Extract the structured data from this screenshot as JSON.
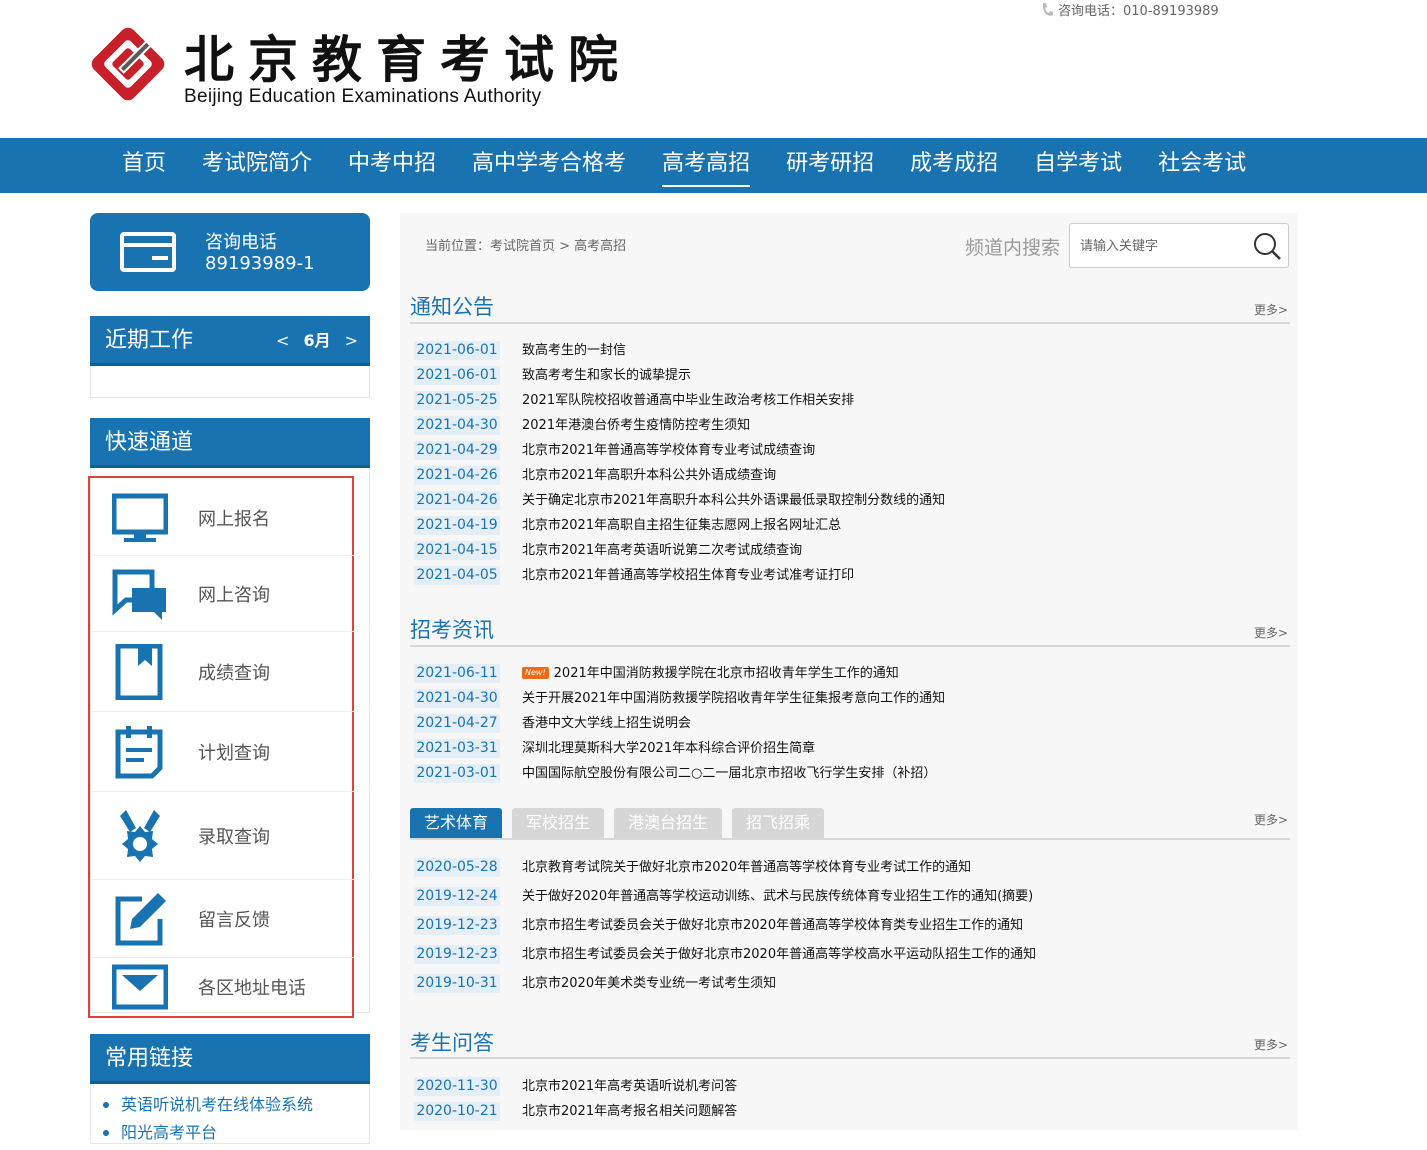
{
  "header": {
    "logo_cn": "北京教育考试院",
    "logo_en": "Beijing Education Examinations Authority",
    "hotline": "咨询电话：010-89193989"
  },
  "nav": {
    "items": [
      {
        "label": "首页"
      },
      {
        "label": "考试院简介"
      },
      {
        "label": "中考中招"
      },
      {
        "label": "高中学考合格考"
      },
      {
        "label": "高考高招",
        "active": true
      },
      {
        "label": "研考研招"
      },
      {
        "label": "成考成招"
      },
      {
        "label": "自学考试"
      },
      {
        "label": "社会考试"
      }
    ]
  },
  "sidebar": {
    "hotline_label": "咨询电话",
    "hotline_number": "89193989-1",
    "recent_title": "近期工作",
    "month": "6月",
    "prev": "<",
    "next": ">",
    "quick_title": "快速通道",
    "quick_items": [
      {
        "label": "网上报名",
        "icon": "monitor-icon"
      },
      {
        "label": "网上咨询",
        "icon": "chat-icon"
      },
      {
        "label": "成绩查询",
        "icon": "bookmark-icon"
      },
      {
        "label": "计划查询",
        "icon": "calendar-icon"
      },
      {
        "label": "录取查询",
        "icon": "medal-icon"
      },
      {
        "label": "留言反馈",
        "icon": "edit-icon"
      },
      {
        "label": "各区地址电话",
        "icon": "envelope-icon"
      }
    ],
    "links_title": "常用链接",
    "links": [
      {
        "label": "英语听说机考在线体验系统"
      },
      {
        "label": "阳光高考平台"
      }
    ]
  },
  "main": {
    "breadcrumb": "当前位置：考试院首页 > 高考高招",
    "search_label": "频道内搜索",
    "search_placeholder": "请输入关键字",
    "more": "更多>",
    "notice": {
      "title": "通知公告",
      "items": [
        {
          "date": "2021-06-01",
          "title": "致高考生的一封信"
        },
        {
          "date": "2021-06-01",
          "title": "致高考考生和家长的诚挚提示"
        },
        {
          "date": "2021-05-25",
          "title": "2021军队院校招收普通高中毕业生政治考核工作相关安排"
        },
        {
          "date": "2021-04-30",
          "title": "2021年港澳台侨考生疫情防控考生须知"
        },
        {
          "date": "2021-04-29",
          "title": "北京市2021年普通高等学校体育专业考试成绩查询"
        },
        {
          "date": "2021-04-26",
          "title": "北京市2021年高职升本科公共外语成绩查询"
        },
        {
          "date": "2021-04-26",
          "title": "关于确定北京市2021年高职升本科公共外语课最低录取控制分数线的通知"
        },
        {
          "date": "2021-04-19",
          "title": "北京市2021年高职自主招生征集志愿网上报名网址汇总"
        },
        {
          "date": "2021-04-15",
          "title": "北京市2021年高考英语听说第二次考试成绩查询"
        },
        {
          "date": "2021-04-05",
          "title": "北京市2021年普通高等学校招生体育专业考试准考证打印"
        }
      ]
    },
    "news": {
      "title": "招考资讯",
      "new_badge": "New!",
      "items": [
        {
          "date": "2021-06-11",
          "title": "2021年中国消防救援学院在北京市招收青年学生工作的通知",
          "is_new": true
        },
        {
          "date": "2021-04-30",
          "title": "关于开展2021年中国消防救援学院招收青年学生征集报考意向工作的通知"
        },
        {
          "date": "2021-04-27",
          "title": "香港中文大学线上招生说明会"
        },
        {
          "date": "2021-03-31",
          "title": "深圳北理莫斯科大学2021年本科综合评价招生简章"
        },
        {
          "date": "2021-03-01",
          "title": "中国国际航空股份有限公司二○二一届北京市招收飞行学生安排（补招）"
        }
      ]
    },
    "tabs": {
      "items": [
        {
          "label": "艺术体育",
          "active": true
        },
        {
          "label": "军校招生"
        },
        {
          "label": "港澳台招生"
        },
        {
          "label": "招飞招乘"
        }
      ],
      "list": [
        {
          "date": "2020-05-28",
          "title": "北京教育考试院关于做好北京市2020年普通高等学校体育专业考试工作的通知"
        },
        {
          "date": "2019-12-24",
          "title": "关于做好2020年普通高等学校运动训练、武术与民族传统体育专业招生工作的通知(摘要)"
        },
        {
          "date": "2019-12-23",
          "title": "北京市招生考试委员会关于做好北京市2020年普通高等学校体育类专业招生工作的通知"
        },
        {
          "date": "2019-12-23",
          "title": "北京市招生考试委员会关于做好北京市2020年普通高等学校高水平运动队招生工作的通知"
        },
        {
          "date": "2019-10-31",
          "title": "北京市2020年美术类专业统一考试考生须知"
        }
      ]
    },
    "qa": {
      "title": "考生问答",
      "items": [
        {
          "date": "2020-11-30",
          "title": "北京市2021年高考英语听说机考问答"
        },
        {
          "date": "2020-10-21",
          "title": "北京市2021年高考报名相关问题解答"
        }
      ]
    }
  }
}
